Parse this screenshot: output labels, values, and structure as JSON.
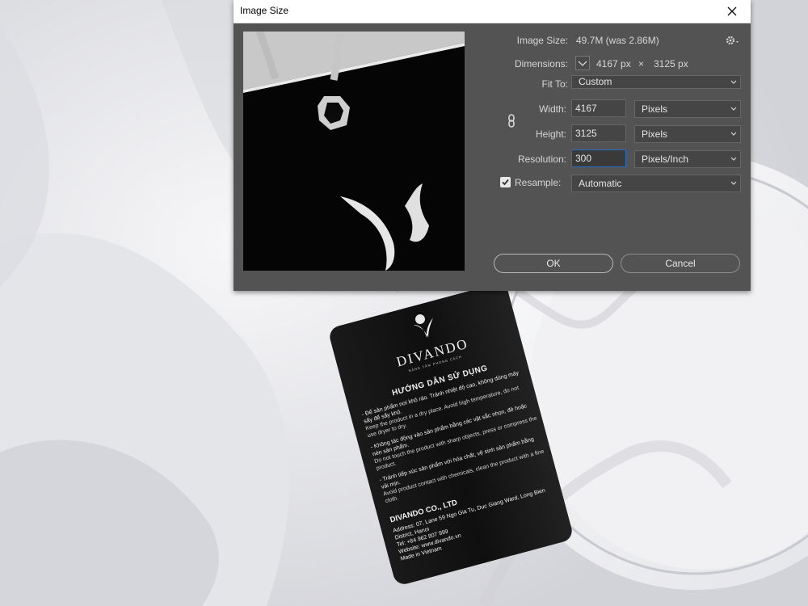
{
  "dialog": {
    "title": "Image Size",
    "image_size_label": "Image Size:",
    "image_size_value": "49.7M (was 2.86M)",
    "dimensions_label": "Dimensions:",
    "dimensions_width": "4167 px",
    "dimensions_sep": "×",
    "dimensions_height": "3125 px",
    "fit_to_label": "Fit To:",
    "fit_to_value": "Custom",
    "width_label": "Width:",
    "width_value": "4167",
    "width_unit": "Pixels",
    "height_label": "Height:",
    "height_value": "3125",
    "height_unit": "Pixels",
    "resolution_label": "Resolution:",
    "resolution_value": "300",
    "resolution_unit": "Pixels/Inch",
    "resample_label": "Resample:",
    "resample_checked": true,
    "resample_value": "Automatic",
    "ok_label": "OK",
    "cancel_label": "Cancel"
  },
  "tag": {
    "brand": "DIVANDO",
    "brand_sub": "NÂNG TẦM PHONG CÁCH",
    "guide_title": "HƯỚNG DẪN SỬ DỤNG",
    "p1_vi": "- Để sản phẩm nơi khô ráo. Tránh nhiệt độ cao, không dùng máy sấy để sấy khô.",
    "p1_en": "Keep the product in a dry place. Avoid high temperature, do not use dryer to dry.",
    "p2_vi": "- Không tác động vào sản phẩm bằng các vật sắc nhọn, đè hoặc nén sản phẩm.",
    "p2_en": "Do not touch the product with sharp objects, press or compress the product.",
    "p3_vi": "- Tránh tiếp xúc sản phẩm với hóa chất, vệ sinh sản phẩm bằng vải mịn.",
    "p3_en": "Avoid product contact with chemicals, clean the product with a fine cloth.",
    "company": "DIVANDO CO., LTD",
    "address": "Address: 07, Lane 59 Ngo Gia Tu, Duc Giang Ward, Long Bien District, Hanoi",
    "tel": "Tel: +84 962 807 999",
    "website": "Website: www.divando.vn",
    "made_in": "Made in Vietnam"
  },
  "icons": {
    "close": "close-icon",
    "settings": "gear-icon",
    "link": "chain-link-icon",
    "dropdown": "chevron-down-icon",
    "check": "checkmark-icon"
  },
  "colors": {
    "dialog_bg": "#535353",
    "field_bg": "#454545",
    "focus_border": "#2d6cc8",
    "tag_black": "#111111"
  }
}
